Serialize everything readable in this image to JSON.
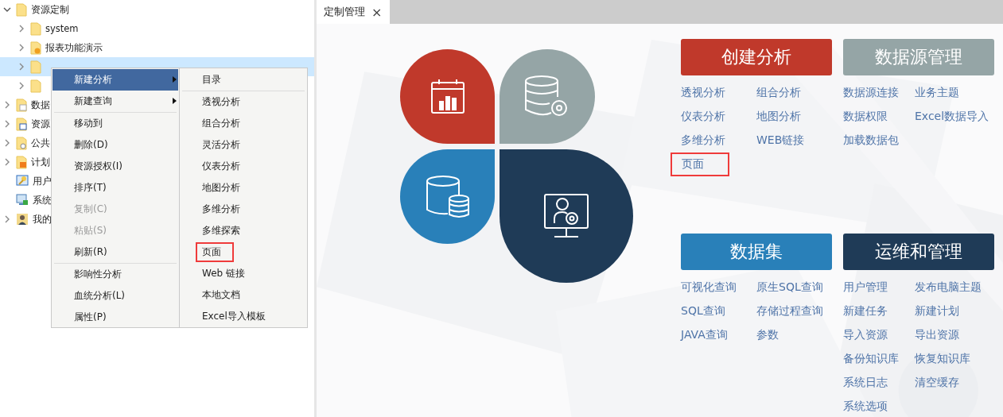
{
  "tree": [
    {
      "label": "资源定制",
      "kind": "folder",
      "expandable": true,
      "expanded": true,
      "selected": false,
      "children": [
        {
          "label": "system",
          "kind": "folder",
          "expandable": true,
          "expanded": false,
          "selected": false
        },
        {
          "label": "报表功能演示",
          "kind": "report",
          "expandable": true,
          "expanded": false,
          "selected": false
        },
        {
          "kind": "folder",
          "expandable": true,
          "expanded": false,
          "selected": true
        },
        {
          "kind": "folder",
          "expandable": true,
          "expanded": false,
          "selected": false
        }
      ]
    },
    {
      "label": "数据",
      "kind": "data",
      "expandable": true,
      "expanded": false,
      "selected": false
    },
    {
      "label": "资源",
      "kind": "edit",
      "expandable": true,
      "expanded": false,
      "selected": false
    },
    {
      "label": "公共",
      "kind": "gear",
      "expandable": true,
      "expanded": false,
      "selected": false
    },
    {
      "label": "计划",
      "kind": "feed",
      "expandable": true,
      "expanded": false,
      "selected": false
    },
    {
      "label": "用户",
      "kind": "key",
      "expandable": false,
      "expanded": false,
      "selected": false
    },
    {
      "label": "系统",
      "kind": "monitor",
      "expandable": false,
      "expanded": false,
      "selected": false
    },
    {
      "label": "我的",
      "kind": "person",
      "expandable": true,
      "expanded": false,
      "selected": false
    }
  ],
  "context_menu": [
    {
      "kind": "item",
      "label": "新建分析",
      "submenu": true,
      "disabled": false,
      "selected": true
    },
    {
      "kind": "item",
      "label": "新建查询",
      "submenu": true,
      "disabled": false,
      "selected": false
    },
    {
      "kind": "separator"
    },
    {
      "kind": "item",
      "label": "移动到",
      "submenu": false,
      "disabled": false,
      "selected": false
    },
    {
      "kind": "item",
      "label": "删除(D)",
      "submenu": false,
      "disabled": false,
      "selected": false
    },
    {
      "kind": "item",
      "label": "资源授权(I)",
      "submenu": false,
      "disabled": false,
      "selected": false
    },
    {
      "kind": "item",
      "label": "排序(T)",
      "submenu": false,
      "disabled": false,
      "selected": false
    },
    {
      "kind": "item",
      "label": "复制(C)",
      "submenu": false,
      "disabled": true,
      "selected": false
    },
    {
      "kind": "item",
      "label": "粘贴(S)",
      "submenu": false,
      "disabled": true,
      "selected": false
    },
    {
      "kind": "item",
      "label": "刷新(R)",
      "submenu": false,
      "disabled": false,
      "selected": false
    },
    {
      "kind": "separator"
    },
    {
      "kind": "item",
      "label": "影响性分析",
      "submenu": false,
      "disabled": false,
      "selected": false
    },
    {
      "kind": "item",
      "label": "血统分析(L)",
      "submenu": false,
      "disabled": false,
      "selected": false
    },
    {
      "kind": "item",
      "label": "属性(P)",
      "submenu": false,
      "disabled": false,
      "selected": false
    }
  ],
  "submenu": [
    {
      "kind": "item",
      "label": "目录",
      "highlighted": false
    },
    {
      "kind": "separator"
    },
    {
      "kind": "item",
      "label": "透视分析",
      "highlighted": false
    },
    {
      "kind": "item",
      "label": "组合分析",
      "highlighted": false
    },
    {
      "kind": "item",
      "label": "灵活分析",
      "highlighted": false
    },
    {
      "kind": "item",
      "label": "仪表分析",
      "highlighted": false
    },
    {
      "kind": "item",
      "label": "地图分析",
      "highlighted": false
    },
    {
      "kind": "item",
      "label": "多维分析",
      "highlighted": false
    },
    {
      "kind": "item",
      "label": "多维探索",
      "highlighted": false
    },
    {
      "kind": "item",
      "label": "页面",
      "highlighted": true
    },
    {
      "kind": "item",
      "label": "Web 链接",
      "highlighted": false
    },
    {
      "kind": "item",
      "label": "本地文档",
      "highlighted": false
    },
    {
      "kind": "item",
      "label": "Excel导入模板",
      "highlighted": false
    }
  ],
  "tabs": [
    {
      "label": "定制管理",
      "selected": true,
      "close": "×"
    }
  ],
  "sections": [
    {
      "title": "创建分析",
      "color": "#c0392b",
      "links": [
        {
          "label": "透视分析",
          "highlighted": false
        },
        {
          "label": "组合分析",
          "highlighted": false
        },
        {
          "label": "仪表分析",
          "highlighted": false
        },
        {
          "label": "地图分析",
          "highlighted": false
        },
        {
          "label": "多维分析",
          "highlighted": false
        },
        {
          "label": "WEB链接",
          "highlighted": false
        },
        {
          "label": "页面",
          "highlighted": true
        }
      ]
    },
    {
      "title": "数据源管理",
      "color": "#95a5a6",
      "links": [
        {
          "label": "数据源连接",
          "highlighted": false
        },
        {
          "label": "业务主题",
          "highlighted": false
        },
        {
          "label": "数据权限",
          "highlighted": false
        },
        {
          "label": "Excel数据导入",
          "highlighted": false
        },
        {
          "label": "加载数据包",
          "highlighted": false
        }
      ]
    },
    {
      "title": "数据集",
      "color": "#2980b9",
      "links": [
        {
          "label": "可视化查询",
          "highlighted": false
        },
        {
          "label": "原生SQL查询",
          "highlighted": false
        },
        {
          "label": "SQL查询",
          "highlighted": false
        },
        {
          "label": "存储过程查询",
          "highlighted": false
        },
        {
          "label": "JAVA查询",
          "highlighted": false
        },
        {
          "label": "参数",
          "highlighted": false
        }
      ]
    },
    {
      "title": "运维和管理",
      "color": "#1f3b57",
      "links": [
        {
          "label": "用户管理",
          "highlighted": false
        },
        {
          "label": "发布电脑主题",
          "highlighted": false
        },
        {
          "label": "新建任务",
          "highlighted": false
        },
        {
          "label": "新建计划",
          "highlighted": false
        },
        {
          "label": "导入资源",
          "highlighted": false
        },
        {
          "label": "导出资源",
          "highlighted": false
        },
        {
          "label": "备份知识库",
          "highlighted": false
        },
        {
          "label": "恢复知识库",
          "highlighted": false
        },
        {
          "label": "系统日志",
          "highlighted": false
        },
        {
          "label": "清空缓存",
          "highlighted": false
        },
        {
          "label": "系统选项",
          "highlighted": false
        }
      ]
    }
  ]
}
